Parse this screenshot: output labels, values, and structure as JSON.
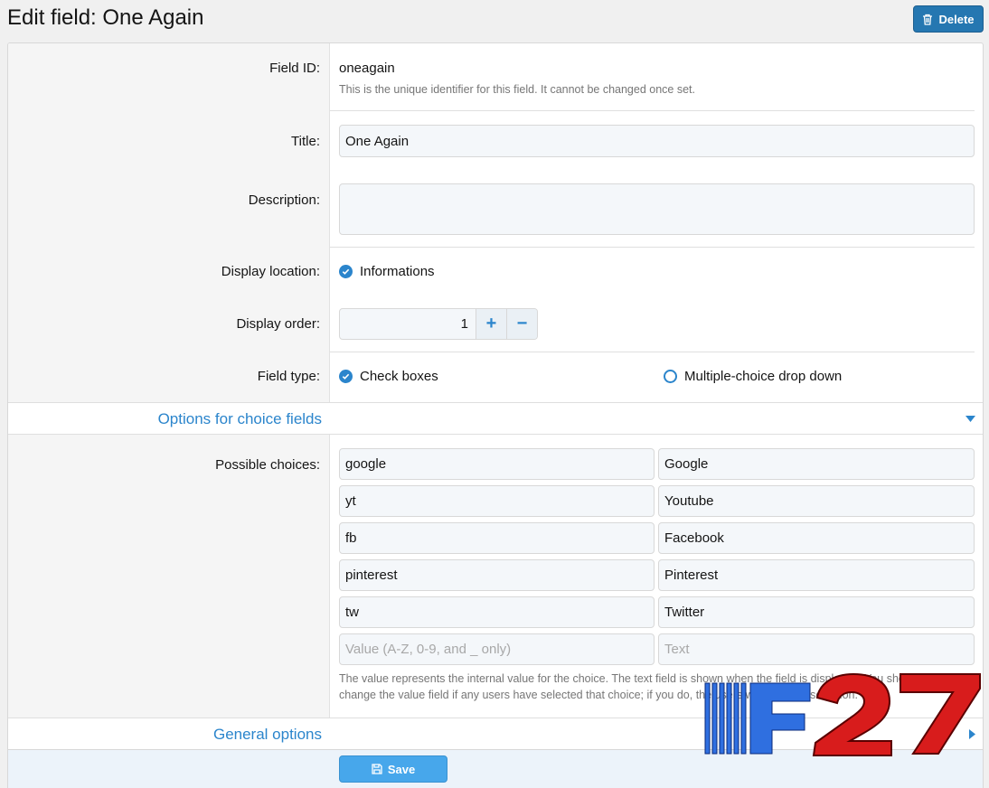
{
  "header": {
    "title": "Edit field: One Again",
    "delete_label": "Delete"
  },
  "form": {
    "field_id": {
      "label": "Field ID:",
      "value": "oneagain",
      "hint": "This is the unique identifier for this field. It cannot be changed once set."
    },
    "title": {
      "label": "Title:",
      "value": "One Again"
    },
    "description": {
      "label": "Description:",
      "value": ""
    },
    "display_location": {
      "label": "Display location:",
      "option": "Informations",
      "checked": true
    },
    "display_order": {
      "label": "Display order:",
      "value": "1",
      "plus": "+",
      "minus": "−"
    },
    "field_type": {
      "label": "Field type:",
      "options": [
        {
          "label": "Check boxes",
          "selected": true
        },
        {
          "label": "Multiple-choice drop down",
          "selected": false
        }
      ]
    }
  },
  "choices_section": {
    "title": "Options for choice fields",
    "label": "Possible choices:",
    "rows": [
      {
        "value": "google",
        "text": "Google"
      },
      {
        "value": "yt",
        "text": "Youtube"
      },
      {
        "value": "fb",
        "text": "Facebook"
      },
      {
        "value": "pinterest",
        "text": "Pinterest"
      },
      {
        "value": "tw",
        "text": "Twitter"
      }
    ],
    "value_placeholder": "Value (A-Z, 0-9, and _ only)",
    "text_placeholder": "Text",
    "hint_line1": "The value represents the internal value for the choice. The text field is shown when the field is displayed. You should not",
    "hint_line2": "change the value field if any users have selected that choice; if you do, the users will lose that selection."
  },
  "general_section": {
    "title": "General options"
  },
  "footer": {
    "save_label": "Save"
  },
  "watermark": {
    "text": "F27"
  },
  "colors": {
    "accent": "#2b85cc",
    "delete_bg": "#2577b1",
    "save_bg": "#47a7eb",
    "watermark_blue": "#2f6fe0",
    "watermark_red": "#d81c1c"
  }
}
